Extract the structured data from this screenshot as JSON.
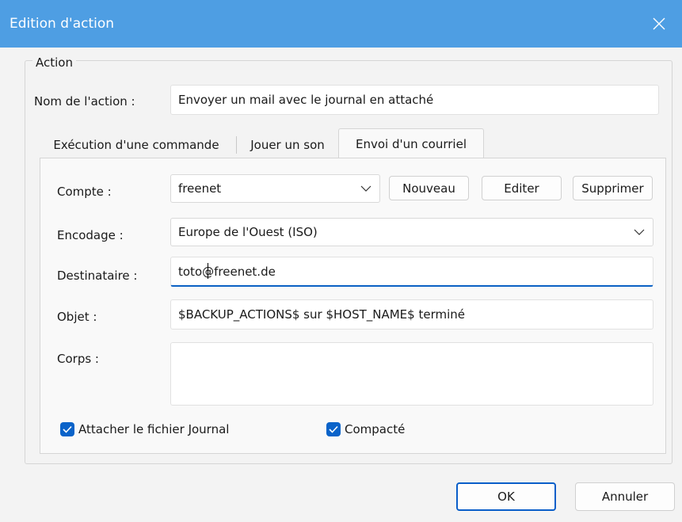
{
  "window": {
    "title": "Edition d'action"
  },
  "group": {
    "legend": "Action"
  },
  "action_name": {
    "label": "Nom de l'action :",
    "value": "Envoyer un mail avec le journal en attaché"
  },
  "tabs": [
    {
      "label": "Exécution d'une commande",
      "active": false
    },
    {
      "label": "Jouer un son",
      "active": false
    },
    {
      "label": "Envoi d'un courriel",
      "active": true
    }
  ],
  "form": {
    "account": {
      "label": "Compte :",
      "value": "freenet"
    },
    "encoding": {
      "label": "Encodage :",
      "value": "Europe de l'Ouest (ISO)"
    },
    "recipient": {
      "label": "Destinataire :",
      "value": "toto@freenet.de"
    },
    "subject": {
      "label": "Objet :",
      "value": "$BACKUP_ACTIONS$ sur $HOST_NAME$ terminé"
    },
    "body": {
      "label": "Corps :",
      "value": ""
    }
  },
  "account_buttons": {
    "new": "Nouveau",
    "edit": "Editer",
    "delete": "Supprimer"
  },
  "checkboxes": {
    "attach_log": {
      "label": "Attacher le fichier Journal",
      "checked": true
    },
    "compressed": {
      "label": "Compacté",
      "checked": true
    }
  },
  "footer": {
    "ok": "OK",
    "cancel": "Annuler"
  },
  "colors": {
    "titlebar": "#4e9ee3",
    "accent": "#0a63c9",
    "body": "#f3f3f3"
  },
  "icons": {
    "close": "close-icon",
    "chevron": "chevron-down-icon",
    "check": "checkmark-icon"
  }
}
